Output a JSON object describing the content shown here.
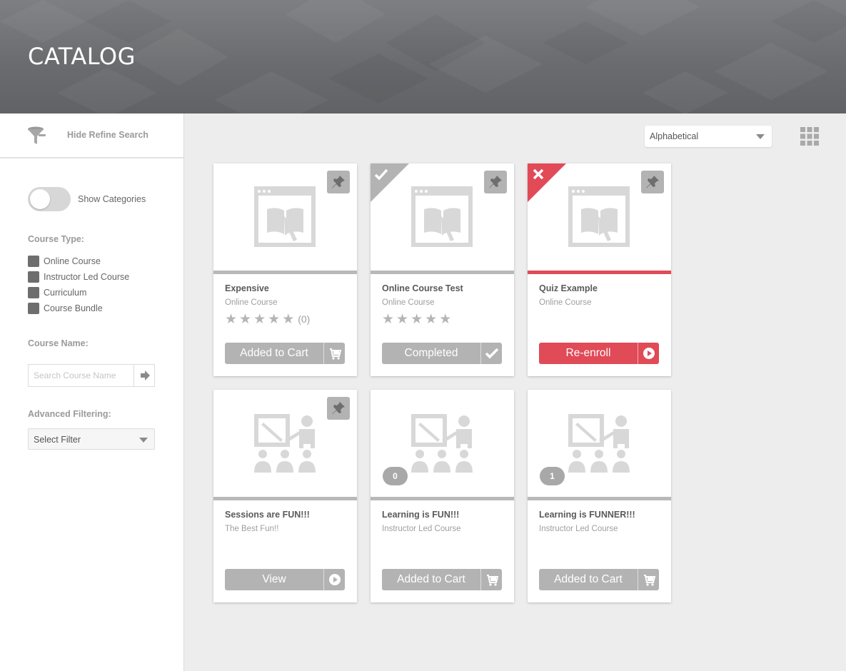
{
  "header": {
    "title": "CATALOG"
  },
  "sidebar": {
    "refine_label": "Hide Refine Search",
    "show_categories_label": "Show Categories",
    "course_type_label": "Course Type:",
    "course_types": [
      "Online Course",
      "Instructor Led Course",
      "Curriculum",
      "Course Bundle"
    ],
    "course_name_label": "Course Name:",
    "search_placeholder": "Search Course Name",
    "advanced_filter_label": "Advanced Filtering:",
    "select_filter_value": "Select Filter"
  },
  "toolbar": {
    "sort_value": "Alphabetical"
  },
  "courses": [
    {
      "title": "Expensive",
      "subtitle": "Online Course",
      "rating_count": "(0)",
      "action": "Added to Cart"
    },
    {
      "title": "Online Course Test",
      "subtitle": "Online Course",
      "action": "Completed"
    },
    {
      "title": "Quiz Example",
      "subtitle": "Online Course",
      "action": "Re-enroll"
    },
    {
      "title": "Sessions are FUN!!!",
      "subtitle": "The Best Fun!!",
      "action": "View"
    },
    {
      "title": "Learning is FUN!!!",
      "subtitle": "Instructor Led Course",
      "badge": "0",
      "action": "Added to Cart"
    },
    {
      "title": "Learning is FUNNER!!!",
      "subtitle": "Instructor Led Course",
      "badge": "1",
      "action": "Added to Cart"
    }
  ],
  "colors": {
    "accent_red": "#e14a57",
    "neutral_gray": "#b3b3b3",
    "header_gray": "#6a6c6f"
  },
  "icons": [
    "funnel-icon",
    "grid-view-icon",
    "pin-icon",
    "checkmark-icon",
    "close-icon",
    "cart-icon",
    "play-icon",
    "arrow-right-icon",
    "online-course-icon",
    "classroom-icon"
  ]
}
